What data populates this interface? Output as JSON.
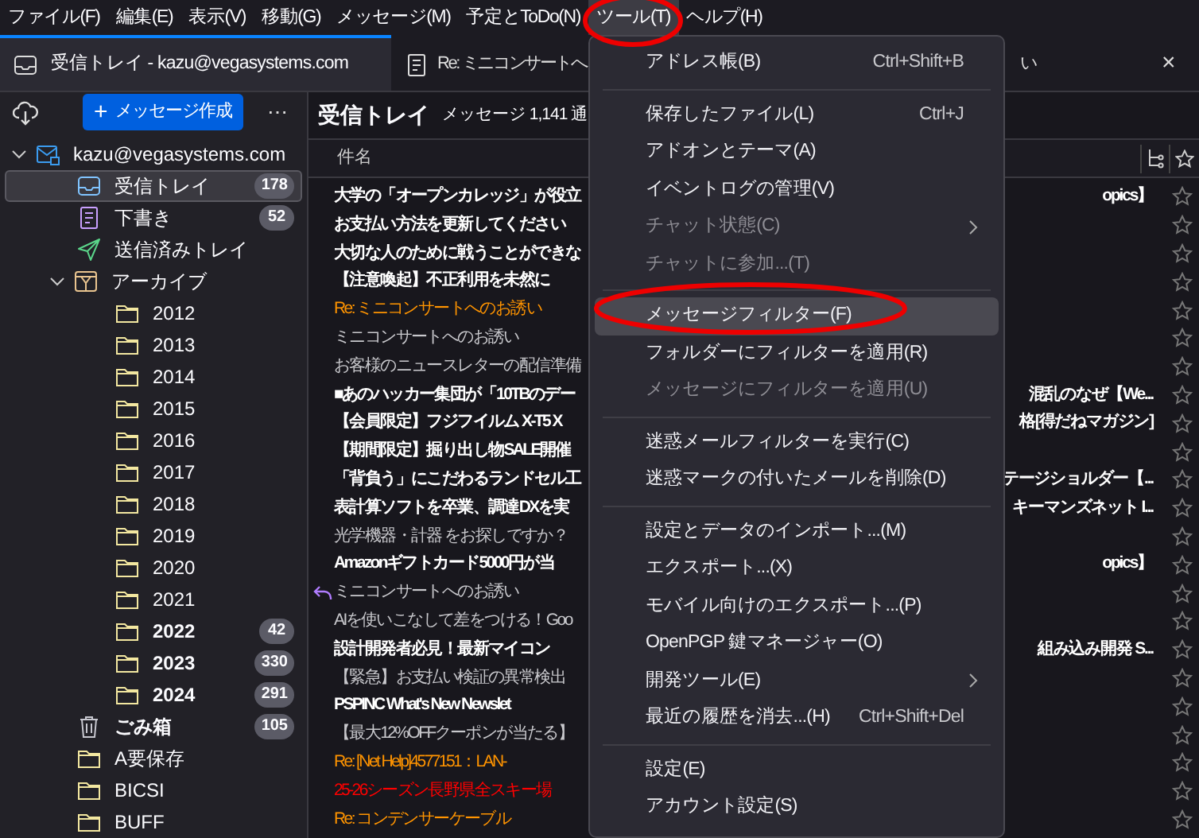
{
  "menubar": [
    {
      "label": "ファイル(F)",
      "selected": false
    },
    {
      "label": "編集(E)",
      "selected": false
    },
    {
      "label": "表示(V)",
      "selected": false
    },
    {
      "label": "移動(G)",
      "selected": false
    },
    {
      "label": "メッセージ(M)",
      "selected": false
    },
    {
      "label": "予定とToDo(N)",
      "selected": false
    },
    {
      "label": "ツール(T)",
      "selected": true
    },
    {
      "label": "ヘルプ(H)",
      "selected": false
    }
  ],
  "tabs": [
    {
      "kind": "folder",
      "label": "受信トレイ - kazu@vegasystems.com",
      "selected": true
    },
    {
      "kind": "message",
      "label": "Re: ミニコンサートへ",
      "label_tail": "い",
      "close": "×",
      "selected": false
    }
  ],
  "folder_pane": {
    "compose_button": "メッセージ作成",
    "compose_plus": "+",
    "more": "⋯",
    "folders": [
      {
        "kind": "account",
        "label": "kazu@vegasystems.com",
        "expanded": true,
        "selected": false,
        "unread": false,
        "children": [
          {
            "kind": "inbox",
            "label": "受信トレイ",
            "count": "178",
            "selected": true,
            "unread": false
          },
          {
            "kind": "drafts",
            "label": "下書き",
            "count": "52",
            "selected": false,
            "unread": false
          },
          {
            "kind": "sent",
            "label": "送信済みトレイ",
            "selected": false,
            "unread": false
          },
          {
            "kind": "archive",
            "label": "アーカイブ",
            "expanded": true,
            "selected": false,
            "unread": false,
            "children": [
              {
                "kind": "folder",
                "label": "2012",
                "selected": false,
                "unread": false
              },
              {
                "kind": "folder",
                "label": "2013",
                "selected": false,
                "unread": false
              },
              {
                "kind": "folder",
                "label": "2014",
                "selected": false,
                "unread": false
              },
              {
                "kind": "folder",
                "label": "2015",
                "selected": false,
                "unread": false
              },
              {
                "kind": "folder",
                "label": "2016",
                "selected": false,
                "unread": false
              },
              {
                "kind": "folder",
                "label": "2017",
                "selected": false,
                "unread": false
              },
              {
                "kind": "folder",
                "label": "2018",
                "selected": false,
                "unread": false
              },
              {
                "kind": "folder",
                "label": "2019",
                "selected": false,
                "unread": false
              },
              {
                "kind": "folder",
                "label": "2020",
                "selected": false,
                "unread": false
              },
              {
                "kind": "folder",
                "label": "2021",
                "selected": false,
                "unread": false
              },
              {
                "kind": "folder",
                "label": "2022",
                "count": "42",
                "selected": false,
                "unread": true
              },
              {
                "kind": "folder",
                "label": "2023",
                "count": "330",
                "selected": false,
                "unread": true
              },
              {
                "kind": "folder",
                "label": "2024",
                "count": "291",
                "selected": false,
                "unread": true
              }
            ]
          },
          {
            "kind": "trash",
            "label": "ごみ箱",
            "count": "105",
            "selected": false,
            "unread": true
          },
          {
            "kind": "folder",
            "label": "A要保存",
            "selected": false,
            "unread": false
          },
          {
            "kind": "folder",
            "label": "BICSI",
            "selected": false,
            "unread": false
          },
          {
            "kind": "folder",
            "label": "BUFF",
            "selected": false,
            "unread": false
          }
        ]
      }
    ]
  },
  "message_list": {
    "title": "受信トレイ",
    "count": "メッセージ 1,141 通",
    "column_subject": "件名",
    "rows": [
      {
        "subject": "大学の「オープンカレッジ」が役立",
        "tail": "opics】",
        "unread": true,
        "replied": false,
        "color": "#ffffff"
      },
      {
        "subject": "お支払い方法を更新してください",
        "unread": true,
        "replied": false,
        "color": "#ffffff"
      },
      {
        "subject": "大切な人のために戦うことができな",
        "unread": true,
        "replied": false,
        "color": "#ffffff"
      },
      {
        "subject": "【注意喚起】不正利用を未然に",
        "unread": true,
        "replied": false,
        "color": "#ffffff"
      },
      {
        "subject": "Re: ミニコンサートへのお誘い",
        "unread": false,
        "replied": false,
        "color": "#ff9400"
      },
      {
        "subject": "ミニコンサートへのお誘い",
        "unread": false,
        "replied": false,
        "color": "#c8c8cc"
      },
      {
        "subject": "お客様のニュースレターの配信準備",
        "unread": false,
        "replied": false,
        "color": "#c8c8cc"
      },
      {
        "subject": "■あのハッカー集団が「10TBのデー",
        "tail": "混乱のなぜ【We...",
        "unread": true,
        "replied": false,
        "color": "#ffffff"
      },
      {
        "subject": "【会員限定】フジフイルム X-T5 X",
        "tail": "格[得だねマガジン]",
        "unread": true,
        "replied": false,
        "color": "#ffffff"
      },
      {
        "subject": "【期間限定】掘り出し物SALE開催",
        "unread": true,
        "replied": false,
        "color": "#ffffff"
      },
      {
        "subject": "「背負う」にこだわるランドセル工",
        "tail": "テージショルダー【...",
        "unread": true,
        "replied": false,
        "color": "#ffffff"
      },
      {
        "subject": "表計算ソフトを卒業、調達DXを実",
        "tail": "キーマンズネット I...",
        "unread": true,
        "replied": false,
        "color": "#ffffff"
      },
      {
        "subject": "光学機器・計器 をお探しですか？",
        "unread": false,
        "replied": false,
        "color": "#c8c8cc"
      },
      {
        "subject": "Amazonギフトカード5000円が当",
        "tail": "opics】",
        "unread": true,
        "replied": false,
        "color": "#ffffff"
      },
      {
        "subject": "ミニコンサートへのお誘い",
        "unread": false,
        "replied": true,
        "color": "#c8c8cc"
      },
      {
        "subject": "AIを使いこなして差をつける！Goo",
        "unread": false,
        "replied": false,
        "color": "#c8c8cc"
      },
      {
        "subject": "設計開発者必見！最新マイコン",
        "tail": "組み込み開発 S...",
        "unread": true,
        "replied": false,
        "color": "#ffffff"
      },
      {
        "subject": "【緊急】お支払い検証の異常検出",
        "unread": false,
        "replied": false,
        "color": "#c8c8cc"
      },
      {
        "subject": "PSPINC What's New Newslet",
        "unread": true,
        "replied": false,
        "color": "#ffffff"
      },
      {
        "subject": "【最大12%OFFクーポンが当たる】",
        "unread": false,
        "replied": false,
        "color": "#c8c8cc"
      },
      {
        "subject": "Re: [Net Help]4577151：LAN-",
        "unread": false,
        "replied": false,
        "color": "#ff9400"
      },
      {
        "subject": "25-26シーズン長野県全スキー場",
        "unread": false,
        "replied": false,
        "color": "#ff0000"
      },
      {
        "subject": "Re: コンデンサーケーブル",
        "unread": false,
        "replied": false,
        "color": "#ff9400"
      }
    ]
  },
  "tools_menu": [
    {
      "kind": "item",
      "label": "アドレス帳(B)",
      "shortcut": "Ctrl+Shift+B",
      "disabled": false,
      "submenu": false,
      "selected": false
    },
    {
      "kind": "separator"
    },
    {
      "kind": "item",
      "label": "保存したファイル(L)",
      "shortcut": "Ctrl+J",
      "disabled": false,
      "submenu": false,
      "selected": false
    },
    {
      "kind": "item",
      "label": "アドオンとテーマ(A)",
      "disabled": false,
      "submenu": false,
      "selected": false
    },
    {
      "kind": "item",
      "label": "イベントログの管理(V)",
      "disabled": false,
      "submenu": false,
      "selected": false
    },
    {
      "kind": "item",
      "label": "チャット状態(C)",
      "disabled": true,
      "submenu": true,
      "selected": false
    },
    {
      "kind": "item",
      "label": "チャットに参加...(T)",
      "disabled": true,
      "submenu": false,
      "selected": false
    },
    {
      "kind": "separator"
    },
    {
      "kind": "item",
      "label": "メッセージフィルター(F)",
      "disabled": false,
      "submenu": false,
      "selected": true
    },
    {
      "kind": "item",
      "label": "フォルダーにフィルターを適用(R)",
      "disabled": false,
      "submenu": false,
      "selected": false
    },
    {
      "kind": "item",
      "label": "メッセージにフィルターを適用(U)",
      "disabled": true,
      "submenu": false,
      "selected": false
    },
    {
      "kind": "separator"
    },
    {
      "kind": "item",
      "label": "迷惑メールフィルターを実行(C)",
      "disabled": false,
      "submenu": false,
      "selected": false
    },
    {
      "kind": "item",
      "label": "迷惑マークの付いたメールを削除(D)",
      "disabled": false,
      "submenu": false,
      "selected": false
    },
    {
      "kind": "separator"
    },
    {
      "kind": "item",
      "label": "設定とデータのインポート...(M)",
      "disabled": false,
      "submenu": false,
      "selected": false
    },
    {
      "kind": "item",
      "label": "エクスポート...(X)",
      "disabled": false,
      "submenu": false,
      "selected": false
    },
    {
      "kind": "item",
      "label": "モバイル向けのエクスポート...(P)",
      "disabled": false,
      "submenu": false,
      "selected": false
    },
    {
      "kind": "item",
      "label": "OpenPGP 鍵マネージャー(O)",
      "disabled": false,
      "submenu": false,
      "selected": false
    },
    {
      "kind": "item",
      "label": "開発ツール(E)",
      "disabled": false,
      "submenu": true,
      "selected": false
    },
    {
      "kind": "item",
      "label": "最近の履歴を消去...(H)",
      "shortcut": "Ctrl+Shift+Del",
      "disabled": false,
      "submenu": false,
      "selected": false
    },
    {
      "kind": "separator"
    },
    {
      "kind": "item",
      "label": "設定(E)",
      "disabled": false,
      "submenu": false,
      "selected": false
    },
    {
      "kind": "item",
      "label": "アカウント設定(S)",
      "disabled": false,
      "submenu": false,
      "selected": false
    }
  ]
}
